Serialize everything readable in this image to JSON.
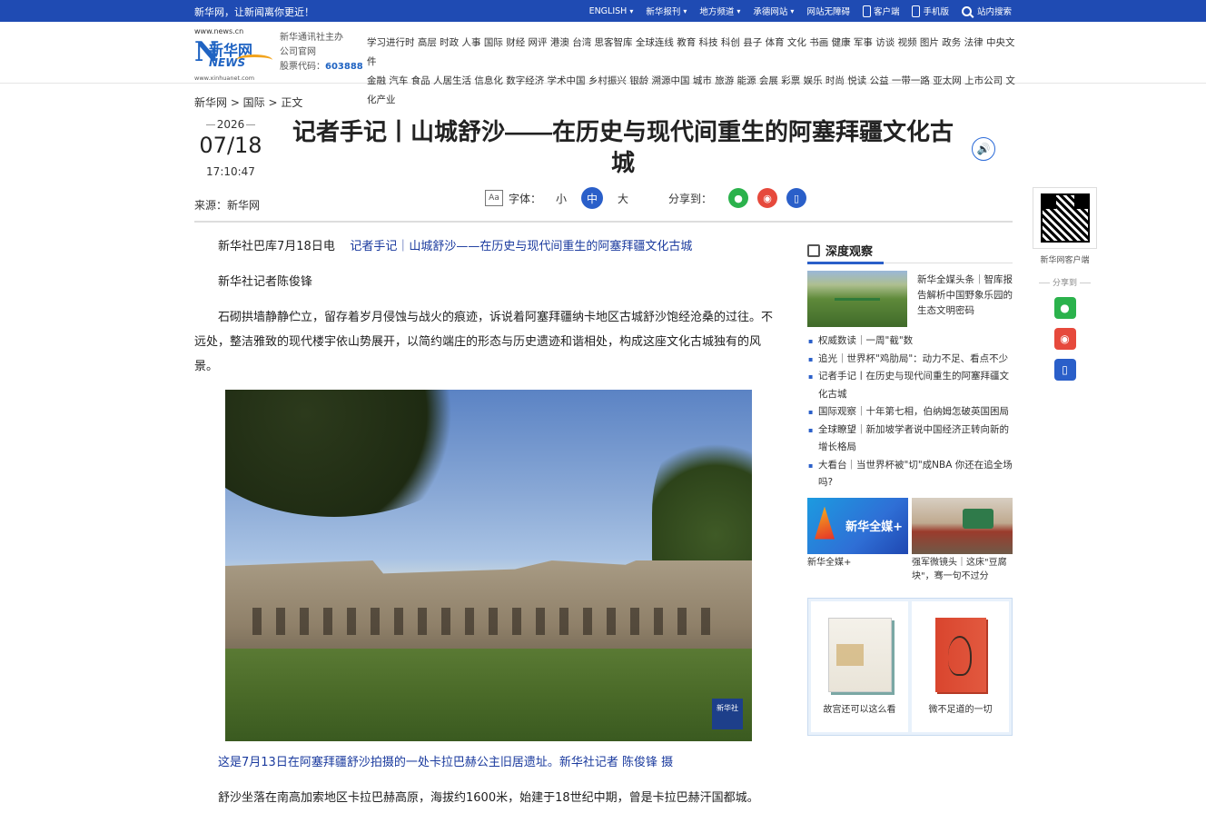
{
  "topbar": {
    "slogan": "新华网，让新闻离你更近！",
    "nav": [
      {
        "label": "ENGLISH",
        "chevron": true
      },
      {
        "label": "新华报刊",
        "chevron": true
      },
      {
        "label": "地方频道",
        "chevron": true
      },
      {
        "label": "承德网站",
        "chevron": true
      },
      {
        "label": "网站无障碍",
        "chevron": false
      }
    ],
    "client_label": "客户端",
    "mobile_label": "手机版",
    "search_label": "站内搜索"
  },
  "header": {
    "logo": {
      "url_top": "www.news.cn",
      "name_cn": "新华网",
      "name_en": "NEWS",
      "url_bottom": "www.xinhuanet.com"
    },
    "company_line1": "新华通讯社主办",
    "company_line2": "公司官网",
    "stock_label": "股票代码：",
    "stock_code": "603888",
    "channels_row1": "学习进行时 高层 时政 人事 国际 财经 网评 港澳 台湾 思客智库 全球连线 教育 科技 科创 县子 体育 文化 书画 健康 军事 访谈 视频 图片 政务 法律 中央文件",
    "channels_row2": "金融 汽车 食品 人居生活 信息化 数字经济 学术中国 乡村振兴 银龄 溯源中国 城市 旅游 能源 会展 彩票 娱乐 时尚 悦读 公益 一带一路 亚太网 上市公司 文化产业"
  },
  "breadcrumb": "新华网 > 国际 > 正文",
  "date": {
    "year": "2026",
    "month_day": "07/18",
    "time": "17:10:47"
  },
  "source": "来源：新华网",
  "title": "记者手记丨山城舒沙——在历史与现代间重生的阿塞拜疆文化古城",
  "toolbar": {
    "font_label": "字体：",
    "sizes": [
      "小",
      "中",
      "大"
    ],
    "active_size": "中",
    "share_label": "分享到："
  },
  "article": {
    "dateline": "新华社巴库7月18日电",
    "lead_link": "记者手记｜山城舒沙——在历史与现代间重生的阿塞拜疆文化古城",
    "byline": "新华社记者陈俊锋",
    "para1": "石砌拱墙静静伫立，留存着岁月侵蚀与战火的痕迹，诉说着阿塞拜疆纳卡地区古城舒沙饱经沧桑的过往。不远处，整洁雅致的现代楼宇依山势展开，以简约端庄的形态与历史遗迹和谐相处，构成这座文化古城独有的风景。",
    "photo_watermark": "新华社",
    "caption": "这是7月13日在阿塞拜疆舒沙拍摄的一处卡拉巴赫公主旧居遗址。新华社记者 陈俊锋 摄",
    "para2": "舒沙坐落在南高加索地区卡拉巴赫高原，海拔约1600米，始建于18世纪中期，曾是卡拉巴赫汗国都城。"
  },
  "float": {
    "qr_label": "新华网客户端",
    "share_label": "分享到"
  },
  "sidebar": {
    "heading": "深度观察",
    "feature_text": "新华全媒头条｜智库报告解析中国野象乐园的生态文明密码",
    "news": [
      "权威数读｜一周\"截\"数",
      "追光｜世界杯\"鸡肋局\"：动力不足、看点不少",
      "记者手记丨在历史与现代间重生的阿塞拜疆文化古城",
      "国际观察｜十年第七相，伯纳姆怎破英国困局",
      "全球瞭望｜新加坡学者说中国经济正转向新的增长格局",
      "大看台｜当世界杯被\"切\"成NBA 你还在追全场吗?"
    ],
    "promo": [
      {
        "image_text": "新华全媒+",
        "caption": "新华全媒+"
      },
      {
        "image_text": "",
        "caption": "强军微镜头｜这床\"豆腐块\"，骞一句不过分"
      }
    ],
    "books": [
      {
        "cover_title": "故宫还可以这么看",
        "caption": "故宫还可以这么看"
      },
      {
        "cover_title": "微不足道的一切",
        "caption": "微不足道的一切"
      }
    ]
  }
}
